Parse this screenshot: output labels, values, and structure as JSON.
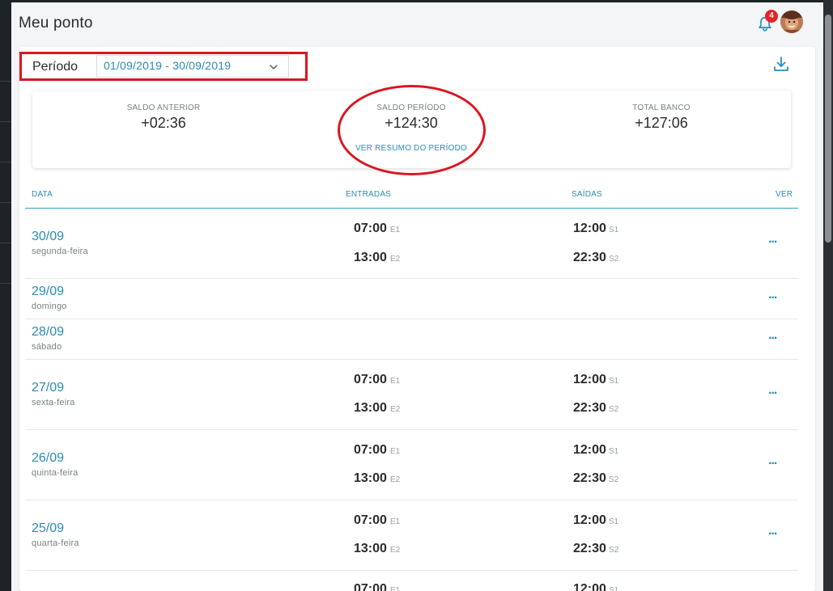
{
  "header": {
    "title": "Meu ponto",
    "notifications_count": "4"
  },
  "period": {
    "label": "Período",
    "value": "01/09/2019 - 30/09/2019"
  },
  "summary": {
    "saldo_anterior_label": "SALDO ANTERIOR",
    "saldo_anterior_value": "+02:36",
    "saldo_periodo_label": "SALDO PERÍODO",
    "saldo_periodo_value": "+124:30",
    "ver_resumo": "VER RESUMO DO PERÍODO",
    "total_banco_label": "TOTAL BANCO",
    "total_banco_value": "+127:06"
  },
  "table": {
    "columns": {
      "data": "DATA",
      "entradas": "ENTRADAS",
      "saidas": "SAÍDAS",
      "ver": "VER"
    },
    "more_label": "...",
    "rows": [
      {
        "date": "30/09",
        "weekday": "segunda-feira",
        "e1": "07:00",
        "e2": "13:00",
        "s1": "12:00",
        "s2": "22:30"
      },
      {
        "date": "29/09",
        "weekday": "domingo"
      },
      {
        "date": "28/09",
        "weekday": "sábado"
      },
      {
        "date": "27/09",
        "weekday": "sexta-feira",
        "e1": "07:00",
        "e2": "13:00",
        "s1": "12:00",
        "s2": "22:30"
      },
      {
        "date": "26/09",
        "weekday": "quinta-feira",
        "e1": "07:00",
        "e2": "13:00",
        "s1": "12:00",
        "s2": "22:30"
      },
      {
        "date": "25/09",
        "weekday": "quarta-feira",
        "e1": "07:00",
        "e2": "13:00",
        "s1": "12:00",
        "s2": "22:30"
      },
      {
        "e1": "07:00",
        "s1": "12:00"
      }
    ],
    "tags": {
      "e1": "E1",
      "e2": "E2",
      "s1": "S1",
      "s2": "S2"
    }
  },
  "colors": {
    "accent": "#2a8cb6",
    "annotation_red": "#d9161f",
    "badge_red": "#e2232b"
  },
  "icons": {
    "notifications": "bell-icon",
    "download": "download-icon",
    "dropdown": "chevron-down-icon",
    "more": "more-horizontal-icon"
  }
}
